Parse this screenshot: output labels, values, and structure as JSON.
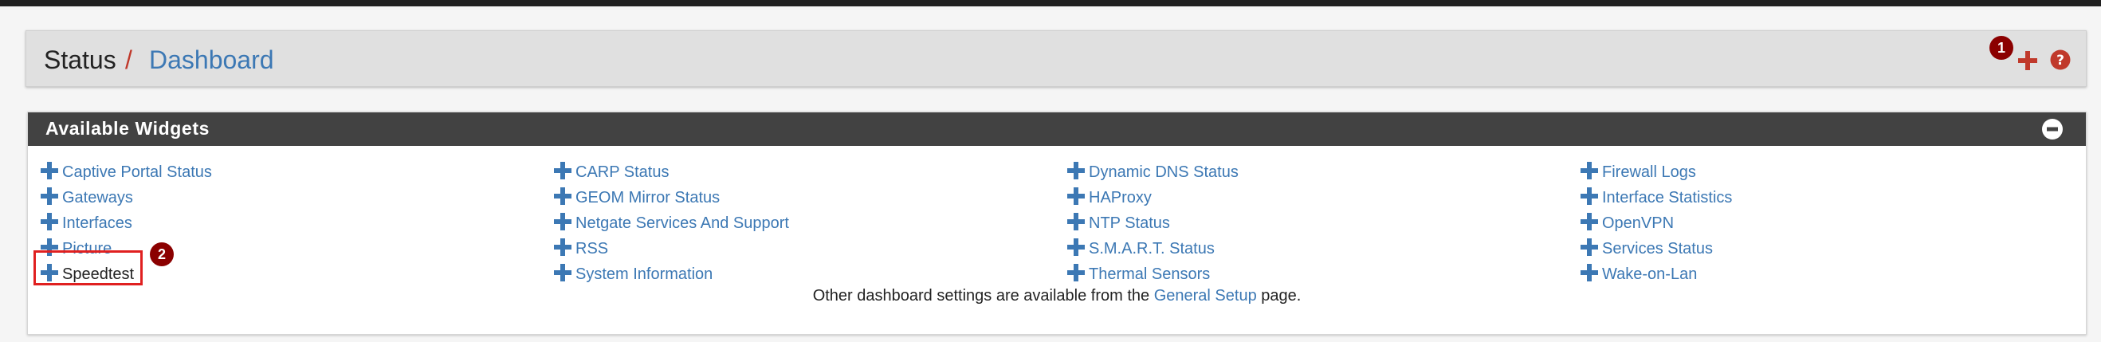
{
  "breadcrumb": {
    "section": "Status",
    "separator": "/",
    "page": "Dashboard"
  },
  "header_actions": {
    "badge_1": "1",
    "add_icon": "plus-icon",
    "help_icon": "question-circle-icon"
  },
  "widgets_panel": {
    "title": "Available Widgets",
    "collapse_icon": "minus-circle-icon",
    "columns": [
      [
        "Captive Portal Status",
        "Gateways",
        "Interfaces",
        "Picture",
        "Speedtest"
      ],
      [
        "CARP Status",
        "GEOM Mirror Status",
        "Netgate Services And Support",
        "RSS",
        "System Information"
      ],
      [
        "Dynamic DNS Status",
        "HAProxy",
        "NTP Status",
        "S.M.A.R.T. Status",
        "Thermal Sensors"
      ],
      [
        "Firewall Logs",
        "Interface Statistics",
        "OpenVPN",
        "Services Status",
        "Wake-on-Lan"
      ]
    ],
    "highlighted_item": "Speedtest",
    "badge_2": "2",
    "footer": {
      "before": "Other dashboard settings are available from the ",
      "link": "General Setup",
      "after": " page."
    }
  },
  "colors": {
    "link": "#3c78b4",
    "accent_red": "#c0392b",
    "badge": "#8b0000",
    "header_bar": "#424242",
    "highlight": "#e02020"
  }
}
